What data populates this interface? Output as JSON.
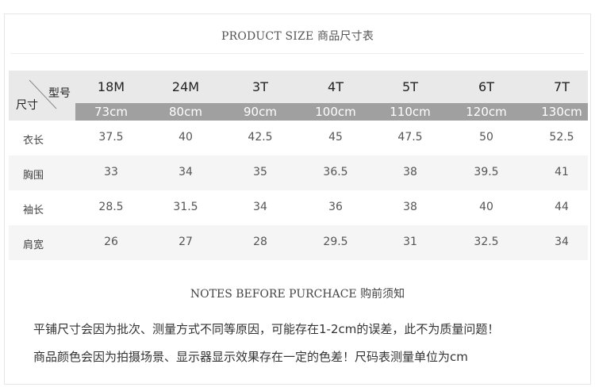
{
  "title": "PRODUCT SIZE 商品尺寸表",
  "table": {
    "corner_top": "型号",
    "corner_bottom": "尺寸",
    "sizes": [
      "18M",
      "24M",
      "3T",
      "4T",
      "5T",
      "6T",
      "7T"
    ],
    "lengths": [
      "73cm",
      "80cm",
      "90cm",
      "100cm",
      "110cm",
      "120cm",
      "130cm"
    ],
    "rows": [
      {
        "label": "衣长",
        "values": [
          "37.5",
          "40",
          "42.5",
          "45",
          "47.5",
          "50",
          "52.5"
        ]
      },
      {
        "label": "胸围",
        "values": [
          "33",
          "34",
          "35",
          "36.5",
          "38",
          "39.5",
          "41"
        ]
      },
      {
        "label": "袖长",
        "values": [
          "28.5",
          "31.5",
          "34",
          "36",
          "38",
          "40",
          "44"
        ]
      },
      {
        "label": "肩宽",
        "values": [
          "26",
          "27",
          "28",
          "29.5",
          "31",
          "32.5",
          "34"
        ]
      }
    ]
  },
  "notes": {
    "title": "NOTES BEFORE PURCHACE 购前须知",
    "line1": "平铺尺寸会因为批次、测量方式不同等原因，可能存在1-2cm的误差，此不为质量问题！",
    "line2": "商品颜色会因为拍摄场景、显示器显示效果存在一定的色差！尺码表测量单位为cm"
  }
}
